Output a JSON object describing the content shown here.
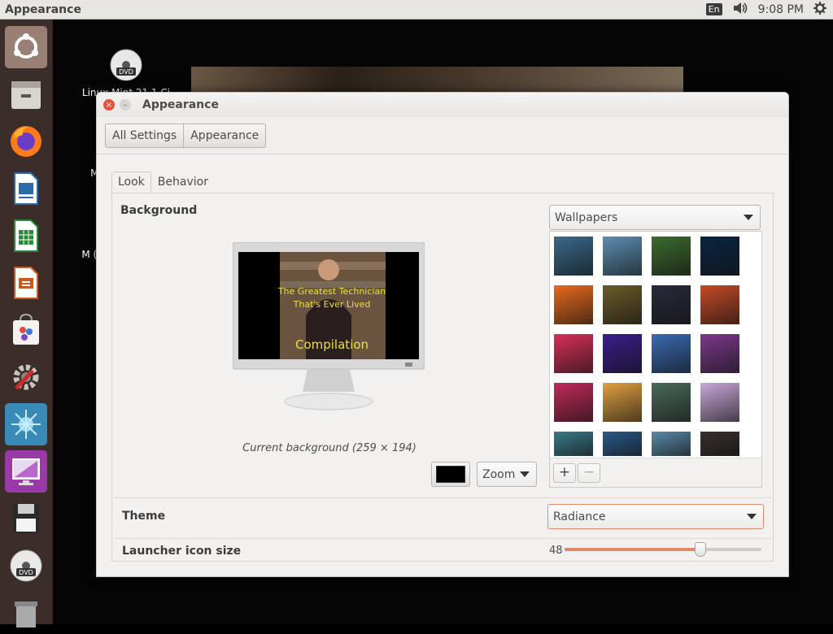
{
  "topbar": {
    "app_title": "Appearance",
    "lang": "En",
    "time": "9:08 PM"
  },
  "desktop": {
    "icons": [
      {
        "label": "Linux Mint 21.1 Ci"
      },
      {
        "label": "Ma"
      },
      {
        "label": "M (US"
      }
    ]
  },
  "window": {
    "title": "Appearance"
  },
  "toolbar": {
    "crumbs": [
      "All Settings",
      "Appearance"
    ]
  },
  "tabs": [
    {
      "label": "Look",
      "active": true
    },
    {
      "label": "Behavior",
      "active": false
    }
  ],
  "background": {
    "label": "Background",
    "preview_text_1": "The Greatest Technician",
    "preview_text_2": "That's Ever Lived",
    "preview_text_3": "Compilation",
    "caption": "Current background (259 × 194)",
    "color": "#000000",
    "fill_mode": "Zoom",
    "source": "Wallpapers",
    "add": "+",
    "remove": "−"
  },
  "theme": {
    "label": "Theme",
    "value": "Radiance"
  },
  "launcher_size": {
    "label": "Launcher icon size",
    "value": "48",
    "fraction": 0.69
  },
  "wallpaper_colors": [
    [
      "#3a6a8a",
      "#5d8fb0",
      "#3c6a2e",
      "#0a2540"
    ],
    [
      "#e86a1e",
      "#6b5a2a",
      "#2a2a3a",
      "#c44a26"
    ],
    [
      "#d8305a",
      "#3a1e8a",
      "#3a6ab0",
      "#7a3a8a"
    ],
    [
      "#c02a5a",
      "#e0a040",
      "#4a6a5a",
      "#c8a8d8"
    ],
    [
      "#3a7a8a",
      "#2a5a8a",
      "#5a8aa8",
      "#3a3030"
    ]
  ]
}
